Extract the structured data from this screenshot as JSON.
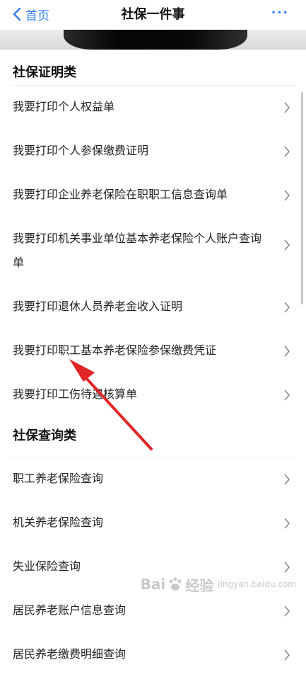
{
  "navbar": {
    "back_label": "首页",
    "title": "社保一件事",
    "more_label": "···",
    "accent_color": "#2f7cf6"
  },
  "sections": [
    {
      "title": "社保证明类",
      "items": [
        "我要打印个人权益单",
        "我要打印个人参保缴费证明",
        "我要打印企业养老保险在职职工信息查询单",
        "我要打印机关事业单位基本养老保险个人账户查询单",
        "我要打印退休人员养老金收入证明",
        "我要打印职工基本养老保险参保缴费凭证",
        "我要打印工伤待遇核算单"
      ]
    },
    {
      "title": "社保查询类",
      "items": [
        "职工养老保险查询",
        "机关养老保险查询",
        "失业保险查询",
        "居民养老账户信息查询",
        "居民养老缴费明细查询"
      ]
    }
  ],
  "annotation": {
    "color": "#e02626",
    "icon": "red-arrow"
  },
  "watermark": {
    "brand_left": "Bai",
    "brand_right": "经验",
    "sub": "jingyan.baidu.com"
  }
}
